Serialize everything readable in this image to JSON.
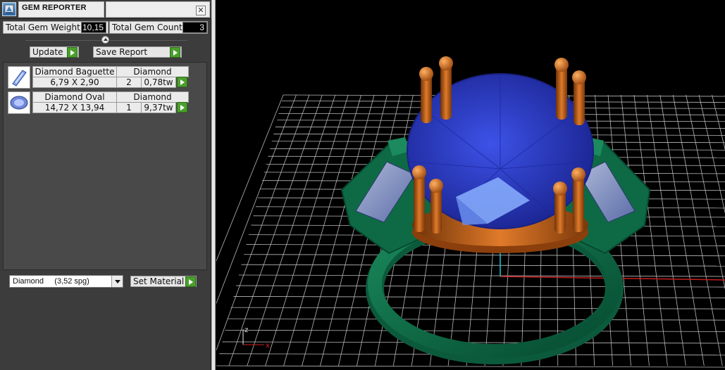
{
  "window": {
    "title": "GEM REPORTER",
    "close_glyph": "✕"
  },
  "icons": {
    "app": "gem-reporter-app-icon",
    "close": "close-icon",
    "collapse": "collapse-arrow-icon",
    "go": "green-play-arrow-icon",
    "dropdown": "chevron-down-icon"
  },
  "stats": {
    "total_weight_label": "Total Gem Weight",
    "total_weight_value": "10,15",
    "total_count_label": "Total Gem Count",
    "total_count_value": "3"
  },
  "actions": {
    "update_label": "Update",
    "save_report_label": "Save Report"
  },
  "gems": [
    {
      "name": "Diamond Baguette",
      "material": "Diamond",
      "size": "6,79 X 2,90",
      "count": "2",
      "weight": "0,78tw",
      "shape_icon": "baguette-gem-icon"
    },
    {
      "name": "Diamond Oval",
      "material": "Diamond",
      "size": "14,72 X 13,94",
      "count": "1",
      "weight": "9,37tw",
      "shape_icon": "oval-gem-icon"
    }
  ],
  "material": {
    "selected": "Diamond     (3,52 spg)",
    "set_label": "Set Material"
  },
  "colors": {
    "go_green": "#4aa02c",
    "panel_bg": "#3c3c3c",
    "ring_green": "#0f6b47",
    "prong_copper": "#c8641a",
    "stone_blue": "#2f3fcf",
    "axis_red": "#d22020",
    "axis_cyan": "#1fc8d8"
  },
  "axis_gizmo": {
    "z": "z",
    "x": "x"
  }
}
